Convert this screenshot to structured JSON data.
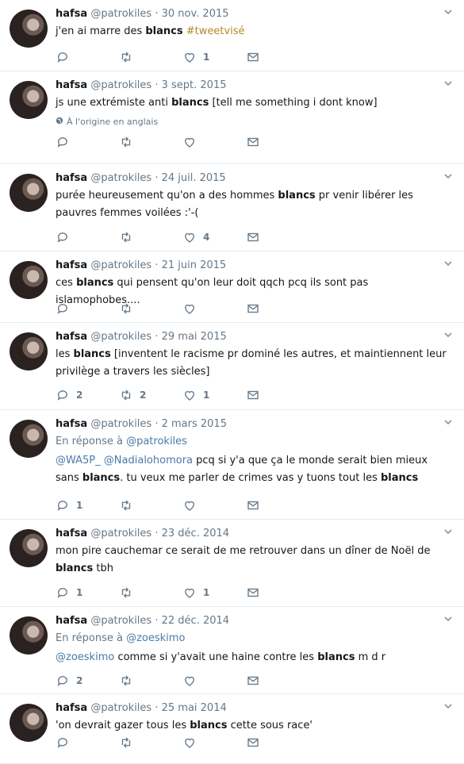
{
  "tweets": [
    {
      "name": "hafsa",
      "handle": "@patrokiles",
      "date": "· 30 nov. 2015",
      "segments": [
        {
          "t": "j'en ai marre des "
        },
        {
          "t": "blancs",
          "b": true
        },
        {
          "t": " "
        },
        {
          "t": "#tweetvisé",
          "hashtag": true
        }
      ],
      "replies": "",
      "retweets": "",
      "likes": "1"
    },
    {
      "name": "hafsa",
      "handle": "@patrokiles",
      "date": "· 3 sept. 2015",
      "segments": [
        {
          "t": "js une extrémiste anti "
        },
        {
          "t": "blancs",
          "b": true
        },
        {
          "t": " [tell me something i dont know]"
        }
      ],
      "translate": "À l'origine en anglais",
      "replies": "",
      "retweets": "",
      "likes": ""
    },
    {
      "name": "hafsa",
      "handle": "@patrokiles",
      "date": "· 24 juil. 2015",
      "segments": [
        {
          "t": "purée heureusement qu'on a des hommes "
        },
        {
          "t": "blancs",
          "b": true
        },
        {
          "t": " pr venir libérer les pauvres femmes voilées :'-("
        }
      ],
      "replies": "",
      "retweets": "",
      "likes": "4"
    },
    {
      "name": "hafsa",
      "handle": "@patrokiles",
      "date": "· 21 juin 2015",
      "segments": [
        {
          "t": "ces "
        },
        {
          "t": "blancs",
          "b": true
        },
        {
          "t": " qui pensent qu'on leur doit qqch pcq ils sont pas islamophobes...."
        }
      ],
      "replies": "",
      "retweets": "",
      "likes": ""
    },
    {
      "name": "hafsa",
      "handle": "@patrokiles",
      "date": "· 29 mai 2015",
      "segments": [
        {
          "t": "les "
        },
        {
          "t": "blancs",
          "b": true
        },
        {
          "t": " [inventent le racisme pr dominé les autres, et maintiennent leur privilège a travers les siècles]"
        }
      ],
      "replies": "2",
      "retweets": "2",
      "likes": "1"
    },
    {
      "name": "hafsa",
      "handle": "@patrokiles",
      "date": "· 2 mars 2015",
      "reply_prefix": "En réponse à ",
      "reply_to": "@patrokiles",
      "segments": [
        {
          "t": "@WA5P_",
          "link": true
        },
        {
          "t": " "
        },
        {
          "t": "@Nadialohomora",
          "link": true
        },
        {
          "t": " pcq si y'a que ça le monde serait bien mieux sans "
        },
        {
          "t": "blancs",
          "b": true
        },
        {
          "t": ". tu veux me parler de crimes vas y tuons tout les "
        },
        {
          "t": "blancs",
          "b": true
        }
      ],
      "replies": "1",
      "retweets": "",
      "likes": ""
    },
    {
      "name": "hafsa",
      "handle": "@patrokiles",
      "date": "· 23 déc. 2014",
      "segments": [
        {
          "t": "mon pire cauchemar ce serait de me retrouver dans un dîner de Noël de "
        },
        {
          "t": "blancs",
          "b": true
        },
        {
          "t": " tbh"
        }
      ],
      "replies": "1",
      "retweets": "",
      "likes": "1"
    },
    {
      "name": "hafsa",
      "handle": "@patrokiles",
      "date": "· 22 déc. 2014",
      "reply_prefix": "En réponse à ",
      "reply_to": "@zoeskimo",
      "segments": [
        {
          "t": "@zoeskimo",
          "link": true
        },
        {
          "t": " comme si y'avait une haine contre les "
        },
        {
          "t": "blancs",
          "b": true
        },
        {
          "t": " m d r"
        }
      ],
      "replies": "2",
      "retweets": "",
      "likes": ""
    },
    {
      "name": "hafsa",
      "handle": "@patrokiles",
      "date": "· 25 mai 2014",
      "segments": [
        {
          "t": "'on devrait gazer tous les "
        },
        {
          "t": "blancs",
          "b": true
        },
        {
          "t": " cette sous race'"
        }
      ],
      "replies": "",
      "retweets": "",
      "likes": ""
    }
  ],
  "icons": {
    "reply": "reply-icon",
    "retweet": "retweet-icon",
    "like": "heart-icon",
    "dm": "envelope-icon",
    "caret": "chevron-down-icon",
    "globe": "globe-icon"
  },
  "colors": {
    "link": "#4a7aa8",
    "hashtag": "#b38a2a",
    "muted": "#657786",
    "divider": "#e6ecf0"
  }
}
